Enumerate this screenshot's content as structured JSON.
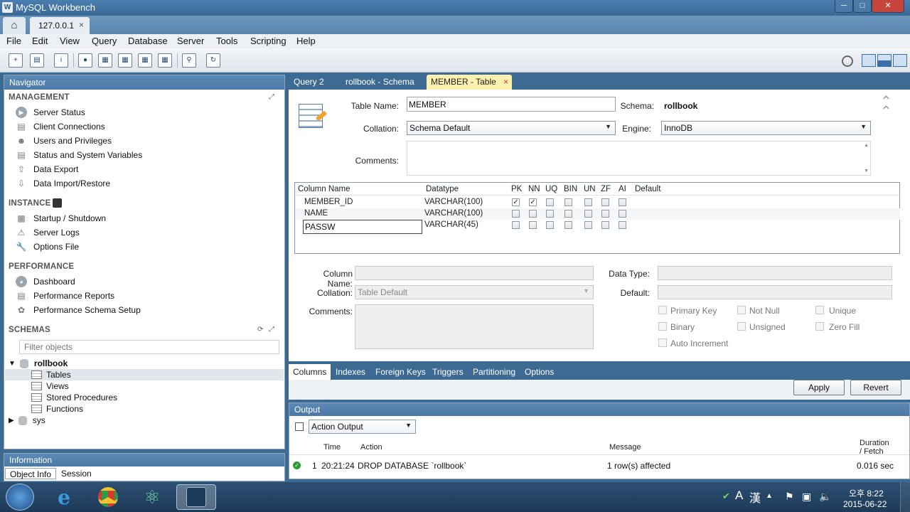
{
  "window": {
    "title": "MySQL Workbench",
    "min_symbol": "─",
    "max_symbol": "□",
    "close_symbol": "✕"
  },
  "connection_tab": {
    "label": "127.0.0.1",
    "close": "×"
  },
  "menu": [
    "File",
    "Edit",
    "View",
    "Query",
    "Database",
    "Server",
    "Tools",
    "Scripting",
    "Help"
  ],
  "navigator": {
    "title": "Navigator",
    "management": {
      "heading": "MANAGEMENT",
      "items": [
        "Server Status",
        "Client Connections",
        "Users and Privileges",
        "Status and System Variables",
        "Data Export",
        "Data Import/Restore"
      ]
    },
    "instance": {
      "heading": "INSTANCE",
      "items": [
        "Startup / Shutdown",
        "Server Logs",
        "Options File"
      ]
    },
    "performance": {
      "heading": "PERFORMANCE",
      "items": [
        "Dashboard",
        "Performance Reports",
        "Performance Schema Setup"
      ]
    },
    "schemas": {
      "heading": "SCHEMAS",
      "filter_placeholder": "Filter objects",
      "db_name": "rollbook",
      "children": [
        "Tables",
        "Views",
        "Stored Procedures",
        "Functions"
      ],
      "other_db": "sys"
    }
  },
  "information": {
    "title": "Information",
    "tabs": [
      "Object Info",
      "Session"
    ]
  },
  "editor_tabs": [
    "Query 2",
    "rollbook - Schema",
    "MEMBER - Table"
  ],
  "editor_tab_close": "×",
  "table_editor": {
    "table_name_label": "Table Name:",
    "table_name": "MEMBER",
    "schema_label": "Schema:",
    "schema_value": "rollbook",
    "collation_label": "Collation:",
    "collation_value": "Schema Default",
    "engine_label": "Engine:",
    "engine_value": "InnoDB",
    "comments_label": "Comments:",
    "grid_headers": [
      "Column Name",
      "Datatype",
      "PK",
      "NN",
      "UQ",
      "BIN",
      "UN",
      "ZF",
      "AI",
      "Default"
    ],
    "rows": [
      {
        "name": "MEMBER_ID",
        "type": "VARCHAR(100)",
        "pk": true,
        "nn": true
      },
      {
        "name": "NAME",
        "type": "VARCHAR(100)",
        "pk": false,
        "nn": false
      },
      {
        "name": "PASSW",
        "type": "VARCHAR(45)",
        "pk": false,
        "nn": false
      }
    ],
    "check_mark": "✓",
    "detail": {
      "column_name_label": "Column Name:",
      "collation_label": "Collation:",
      "collation_value": "Table Default",
      "comments_label": "Comments:",
      "data_type_label": "Data Type:",
      "default_label": "Default:",
      "options": [
        "Primary Key",
        "Not Null",
        "Unique",
        "Binary",
        "Unsigned",
        "Zero Fill",
        "Auto Increment"
      ]
    },
    "sub_tabs": [
      "Columns",
      "Indexes",
      "Foreign Keys",
      "Triggers",
      "Partitioning",
      "Options"
    ],
    "apply_label": "Apply",
    "revert_label": "Revert"
  },
  "output": {
    "title": "Output",
    "selector_value": "Action Output",
    "headers": {
      "time": "Time",
      "action": "Action",
      "message": "Message",
      "duration": "Duration\n/ Fetch"
    },
    "rows": [
      {
        "num": "1",
        "time": "20:21:24",
        "action": "DROP DATABASE `rollbook`",
        "message": "1 row(s) affected",
        "duration": "0.016 sec"
      }
    ]
  },
  "taskbar": {
    "ime_lang": "A",
    "ime_hanja": "漢",
    "time": "오후 8:22",
    "date": "2015-06-22"
  },
  "colors": {
    "window_blue": "#3d6a93",
    "panel_header": "#4b78a4",
    "active_tab": "#fdf1b0",
    "ok_green": "#2e9b38"
  }
}
